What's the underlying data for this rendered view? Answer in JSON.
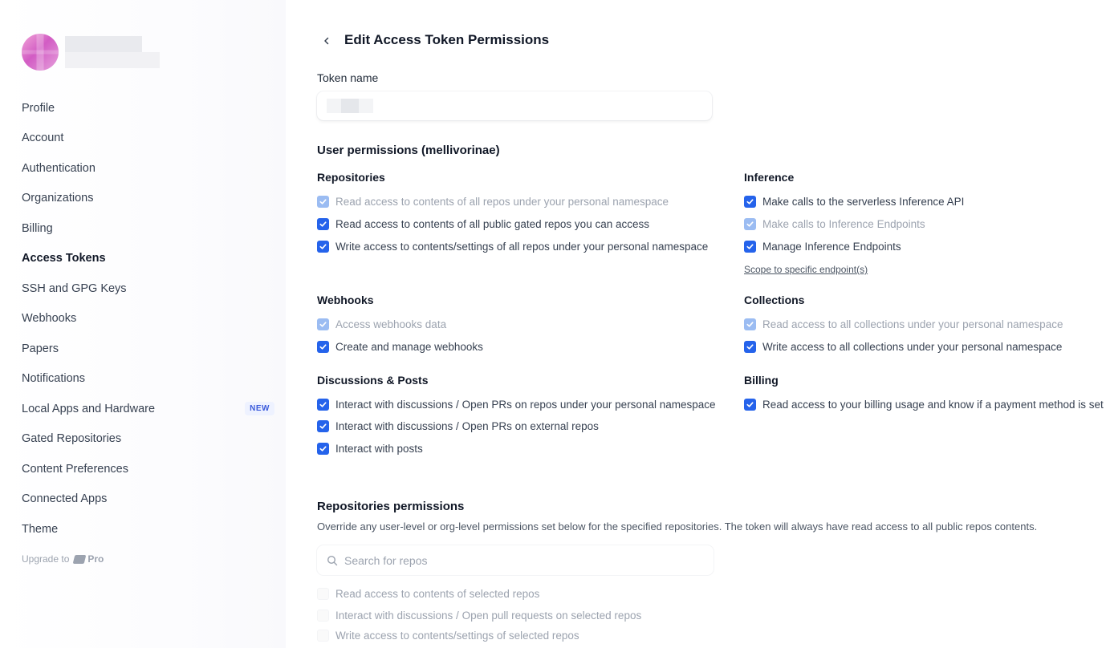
{
  "sidebar": {
    "items": [
      {
        "label": "Profile"
      },
      {
        "label": "Account"
      },
      {
        "label": "Authentication"
      },
      {
        "label": "Organizations"
      },
      {
        "label": "Billing"
      },
      {
        "label": "Access Tokens",
        "active": true
      },
      {
        "label": "SSH and GPG Keys"
      },
      {
        "label": "Webhooks"
      },
      {
        "label": "Papers"
      },
      {
        "label": "Notifications"
      },
      {
        "label": "Local Apps and Hardware",
        "badge": "NEW"
      },
      {
        "label": "Gated Repositories"
      },
      {
        "label": "Content Preferences"
      },
      {
        "label": "Connected Apps"
      },
      {
        "label": "Theme"
      }
    ],
    "upgrade": {
      "prefix": "Upgrade to",
      "pro": "Pro"
    }
  },
  "header": {
    "back_icon": "chevron-left-icon",
    "title": "Edit Access Token Permissions"
  },
  "token": {
    "label": "Token name"
  },
  "user_permissions": {
    "title": "User permissions (mellivorinae)",
    "groups": {
      "repositories": {
        "title": "Repositories",
        "items": [
          {
            "label": "Read access to contents of all repos under your personal namespace",
            "state": "disabled-checked"
          },
          {
            "label": "Read access to contents of all public gated repos you can access",
            "state": "checked"
          },
          {
            "label": "Write access to contents/settings of all repos under your personal namespace",
            "state": "checked"
          }
        ]
      },
      "inference": {
        "title": "Inference",
        "items": [
          {
            "label": "Make calls to the serverless Inference API",
            "state": "checked"
          },
          {
            "label": "Make calls to Inference Endpoints",
            "state": "disabled-checked"
          },
          {
            "label": "Manage Inference Endpoints",
            "state": "checked"
          }
        ],
        "link": "Scope to specific endpoint(s)"
      },
      "webhooks": {
        "title": "Webhooks",
        "items": [
          {
            "label": "Access webhooks data",
            "state": "disabled-checked"
          },
          {
            "label": "Create and manage webhooks",
            "state": "checked"
          }
        ]
      },
      "collections": {
        "title": "Collections",
        "items": [
          {
            "label": "Read access to all collections under your personal namespace",
            "state": "disabled-checked"
          },
          {
            "label": "Write access to all collections under your personal namespace",
            "state": "checked"
          }
        ]
      },
      "discussions": {
        "title": "Discussions & Posts",
        "items": [
          {
            "label": "Interact with discussions / Open PRs on repos under your personal namespace",
            "state": "checked"
          },
          {
            "label": "Interact with discussions / Open PRs on external repos",
            "state": "checked"
          },
          {
            "label": "Interact with posts",
            "state": "checked"
          }
        ]
      },
      "billing": {
        "title": "Billing",
        "items": [
          {
            "label": "Read access to your billing usage and know if a payment method is set",
            "state": "checked"
          }
        ]
      }
    }
  },
  "repo_permissions": {
    "title": "Repositories permissions",
    "description": "Override any user-level or org-level permissions set below for the specified repositories. The token will always have read access to all public repos contents.",
    "search_placeholder": "Search for repos",
    "items": [
      {
        "label": "Read access to contents of selected repos",
        "state": "disabled-unchecked"
      },
      {
        "label": "Interact with discussions / Open pull requests on selected repos",
        "state": "disabled-unchecked"
      },
      {
        "label": "Write access to contents/settings of selected repos",
        "state": "disabled-unchecked"
      }
    ]
  },
  "colors": {
    "accent": "#2563eb",
    "accent_disabled": "#9bbcf2",
    "badge_text": "#3b5bdb"
  }
}
